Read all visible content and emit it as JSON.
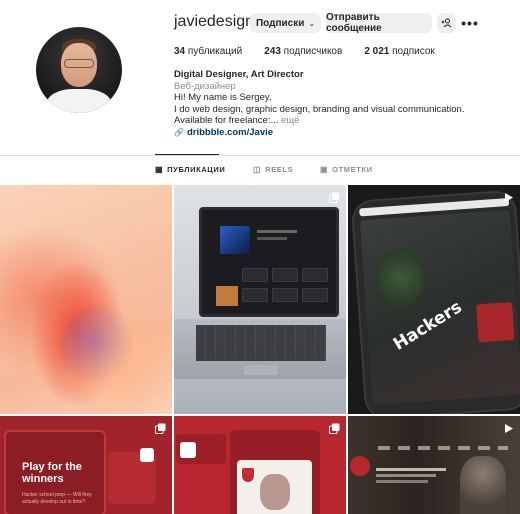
{
  "profile": {
    "username": "javiedesigner",
    "buttons": {
      "subscriptions": "Подписки",
      "message": "Отправить сообщение",
      "add_user": "+A",
      "more": "•••"
    },
    "stats": {
      "posts_count": "34",
      "posts_label": "публикаций",
      "followers_count": "243",
      "followers_label": "подписчиков",
      "following_count": "2 021",
      "following_label": "подписок"
    },
    "bio": {
      "name": "Digital Designer, Art Director",
      "category": "Веб-дизайнер",
      "line1": "Hi! My name is Sergey,",
      "line2": "I do web design, graphic design, branding and visual communication.",
      "line3": "Available for freelance:...",
      "more": "ещё",
      "link": "dribbble.com/Javie"
    }
  },
  "tabs": [
    {
      "label": "ПУБЛИКАЦИИ",
      "icon": "grid-icon",
      "active": true
    },
    {
      "label": "REELS",
      "icon": "reels-icon",
      "active": false
    },
    {
      "label": "ОТМЕТКИ",
      "icon": "tag-icon",
      "active": false
    }
  ],
  "posts": [
    {
      "kind": "image",
      "description_icon": null
    },
    {
      "kind": "image",
      "overlay_icon": "carousel-icon"
    },
    {
      "kind": "video",
      "overlay_icon": "reel-play-icon",
      "text": "Hackers"
    },
    {
      "kind": "image",
      "overlay_icon": "carousel-icon",
      "title": "Play for the winners",
      "subtitle": "Hacker school prep — Will they actually develop out in time?"
    },
    {
      "kind": "image",
      "overlay_icon": "carousel-icon"
    },
    {
      "kind": "video",
      "overlay_icon": "reel-play-icon"
    }
  ],
  "colors": {
    "text": "#262626",
    "muted": "#8e8e8e",
    "link": "#00376b",
    "button_bg": "#efefef",
    "divider": "#dbdbdb"
  }
}
